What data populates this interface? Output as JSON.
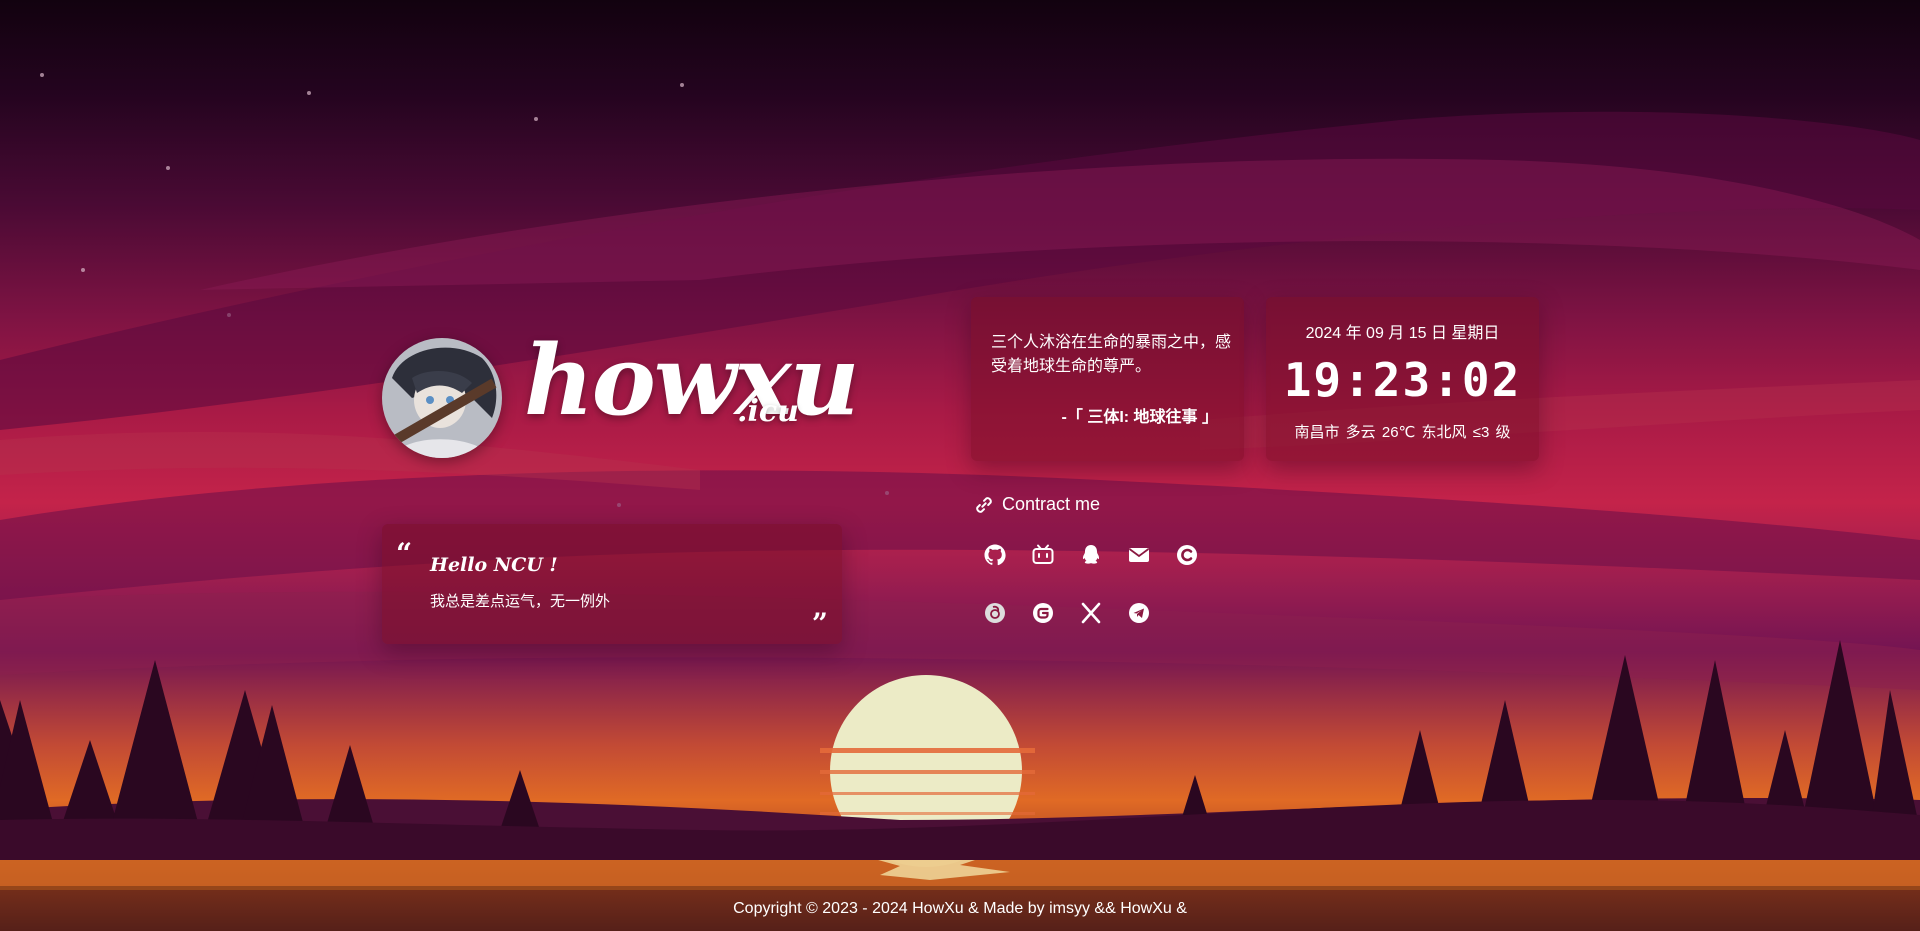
{
  "site": {
    "logo_main": "howxu",
    "logo_suffix": ".icu"
  },
  "hello": {
    "title": "Hello NCU !",
    "text": "我总是差点运气，无一例外"
  },
  "poem": {
    "text": "三个人沐浴在生命的暴雨之中，感受着地球生命的尊严。",
    "source": "-「 三体I: 地球往事 」"
  },
  "clock": {
    "date": "2024 年 09 月 15 日 星期日",
    "time": "19:23:02",
    "weather": "南昌市 多云 26℃ 东北风 ≤3 级"
  },
  "contact": {
    "label": "Contract me",
    "icons": [
      "github-icon",
      "bilibili-icon",
      "qq-icon",
      "mail-icon",
      "csdn-icon",
      "netease-music-icon",
      "gitee-icon",
      "x-icon",
      "telegram-icon"
    ]
  },
  "footer": {
    "text": "Copyright  © 2023 - 2024 HowXu & Made by imsyy && HowXu &"
  },
  "colors": {
    "sky_top": "#12020f",
    "sky_mid": "#c4234a",
    "sun": "#ecebc6",
    "card_bg": "#780e28",
    "text": "#ffffff"
  }
}
